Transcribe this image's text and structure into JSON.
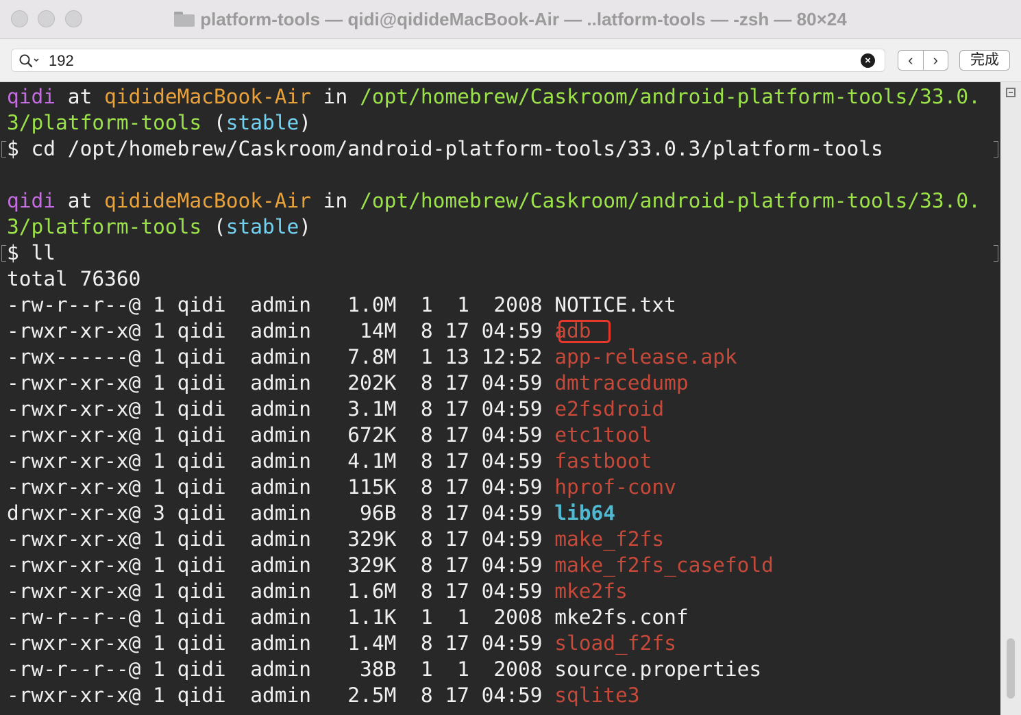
{
  "window": {
    "title": "platform-tools — qidi@qidideMacBook-Air — ..latform-tools — -zsh — 80×24"
  },
  "find_bar": {
    "search_value": "192",
    "done_label": "完成",
    "prev_icon": "‹",
    "next_icon": "›",
    "clear_icon": "×"
  },
  "terminal": {
    "prompt1": {
      "user": "qidi",
      "at": " at ",
      "host": "qidideMacBook-Air",
      "in": " in ",
      "path_part1": "/opt/homebrew/Caskroom/android-platform-tools/33.0.",
      "path_part2": "3/platform-tools",
      "branch_open": " (",
      "branch": "stable",
      "branch_close": ")",
      "command": "$ cd /opt/homebrew/Caskroom/android-platform-tools/33.0.3/platform-tools"
    },
    "prompt2": {
      "user": "qidi",
      "at": " at ",
      "host": "qidideMacBook-Air",
      "in": " in ",
      "path_part1": "/opt/homebrew/Caskroom/android-platform-tools/33.0.",
      "path_part2": "3/platform-tools",
      "branch_open": " (",
      "branch": "stable",
      "branch_close": ")",
      "command": "$ ll"
    },
    "total": "total 76360",
    "files": [
      {
        "meta": "-rw-r--r--@ 1 qidi  admin   1.0M  1  1  2008 ",
        "name": "NOTICE.txt",
        "type": "file"
      },
      {
        "meta": "-rwxr-xr-x@ 1 qidi  admin    14M  8 17 04:59 ",
        "name": "adb",
        "type": "exec"
      },
      {
        "meta": "-rwx------@ 1 qidi  admin   7.8M  1 13 12:52 ",
        "name": "app-release.apk",
        "type": "exec"
      },
      {
        "meta": "-rwxr-xr-x@ 1 qidi  admin   202K  8 17 04:59 ",
        "name": "dmtracedump",
        "type": "exec"
      },
      {
        "meta": "-rwxr-xr-x@ 1 qidi  admin   3.1M  8 17 04:59 ",
        "name": "e2fsdroid",
        "type": "exec"
      },
      {
        "meta": "-rwxr-xr-x@ 1 qidi  admin   672K  8 17 04:59 ",
        "name": "etc1tool",
        "type": "exec"
      },
      {
        "meta": "-rwxr-xr-x@ 1 qidi  admin   4.1M  8 17 04:59 ",
        "name": "fastboot",
        "type": "exec"
      },
      {
        "meta": "-rwxr-xr-x@ 1 qidi  admin   115K  8 17 04:59 ",
        "name": "hprof-conv",
        "type": "exec"
      },
      {
        "meta": "drwxr-xr-x@ 3 qidi  admin    96B  8 17 04:59 ",
        "name": "lib64",
        "type": "dir"
      },
      {
        "meta": "-rwxr-xr-x@ 1 qidi  admin   329K  8 17 04:59 ",
        "name": "make_f2fs",
        "type": "exec"
      },
      {
        "meta": "-rwxr-xr-x@ 1 qidi  admin   329K  8 17 04:59 ",
        "name": "make_f2fs_casefold",
        "type": "exec"
      },
      {
        "meta": "-rwxr-xr-x@ 1 qidi  admin   1.6M  8 17 04:59 ",
        "name": "mke2fs",
        "type": "exec"
      },
      {
        "meta": "-rw-r--r--@ 1 qidi  admin   1.1K  1  1  2008 ",
        "name": "mke2fs.conf",
        "type": "file"
      },
      {
        "meta": "-rwxr-xr-x@ 1 qidi  admin   1.4M  8 17 04:59 ",
        "name": "sload_f2fs",
        "type": "exec"
      },
      {
        "meta": "-rw-r--r--@ 1 qidi  admin    38B  1  1  2008 ",
        "name": "source.properties",
        "type": "file"
      },
      {
        "meta": "-rwxr-xr-x@ 1 qidi  admin   2.5M  8 17 04:59 ",
        "name": "sqlite3",
        "type": "exec"
      }
    ]
  },
  "colors": {
    "user": "#c46ce0",
    "host": "#e8a23c",
    "path": "#9be24a",
    "branch": "#72d0f0",
    "executable": "#c7493a",
    "directory": "#4fbad1",
    "highlight_box": "#e8382a"
  },
  "icons": {
    "folder": "folder-icon",
    "search": "search-icon",
    "clear": "clear-search-icon",
    "prev": "chevron-left-icon",
    "next": "chevron-right-icon",
    "scroll_marker": "marks-icon"
  }
}
